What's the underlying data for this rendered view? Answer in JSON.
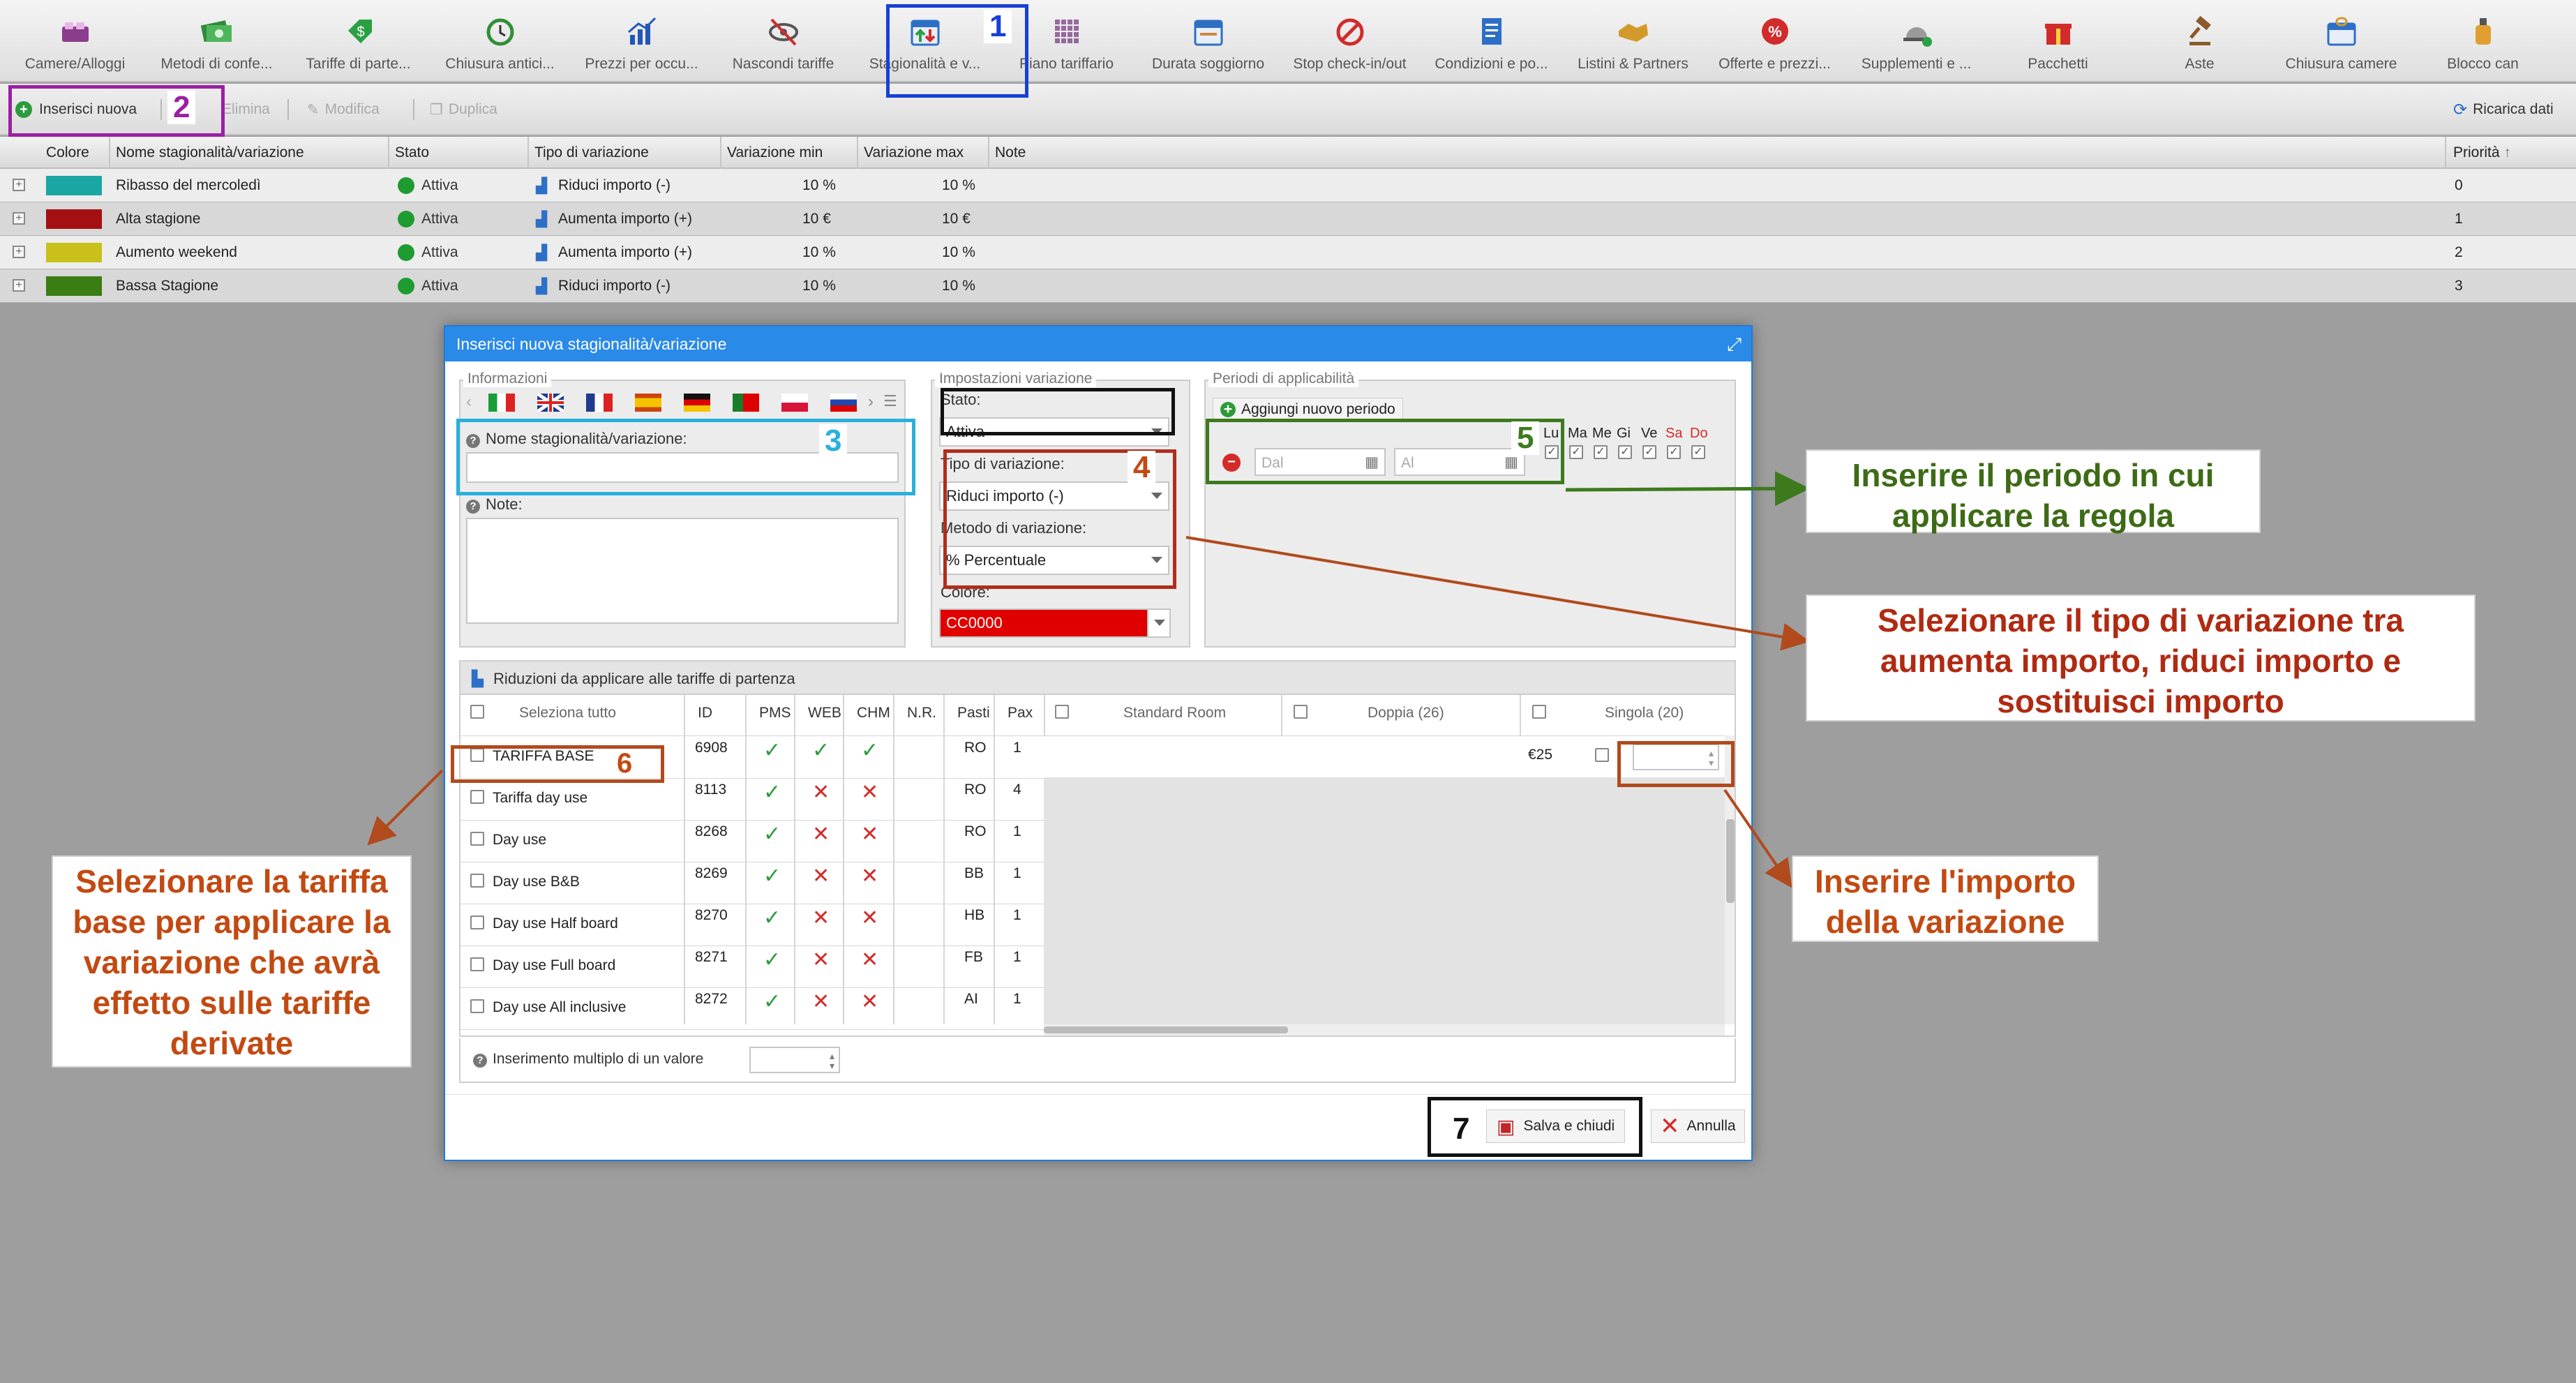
{
  "toolbar": [
    {
      "label": "Camere/Alloggi",
      "icon": "bed-icon",
      "color": "#8a3d8a"
    },
    {
      "label": "Metodi di confe...",
      "icon": "money-icon",
      "color": "#2e8b3a"
    },
    {
      "label": "Tariffe di parte...",
      "icon": "price-tag-icon",
      "color": "#2aa043"
    },
    {
      "label": "Chiusura antici...",
      "icon": "clock-refresh-icon",
      "color": "#2f8f3a"
    },
    {
      "label": "Prezzi per occu...",
      "icon": "bar-chart-icon",
      "color": "#2257b8"
    },
    {
      "label": "Nascondi tariffe",
      "icon": "eye-hidden-icon",
      "color": "#555555"
    },
    {
      "label": "Stagionalità e v...",
      "icon": "calendar-arrows-icon",
      "color": "#2d6fc7"
    },
    {
      "label": "Piano tariffario",
      "icon": "grid-plan-icon",
      "color": "#7a3e86"
    },
    {
      "label": "Durata soggiorno",
      "icon": "calendar-icon",
      "color": "#2f6fc2"
    },
    {
      "label": "Stop check-in/out",
      "icon": "stop-calendar-icon",
      "color": "#d12b2b"
    },
    {
      "label": "Condizioni e po...",
      "icon": "document-icon",
      "color": "#2d6fc7"
    },
    {
      "label": "Listini & Partners",
      "icon": "handshake-icon",
      "color": "#d39a2a"
    },
    {
      "label": "Offerte e prezzi...",
      "icon": "percent-badge-icon",
      "color": "#d12b2b"
    },
    {
      "label": "Supplementi e ...",
      "icon": "service-bell-icon",
      "color": "#555555"
    },
    {
      "label": "Pacchetti",
      "icon": "gift-icon",
      "color": "#d12b2b"
    },
    {
      "label": "Aste",
      "icon": "gavel-icon",
      "color": "#8a5a2a"
    },
    {
      "label": "Chiusura camere",
      "icon": "lock-calendar-icon",
      "color": "#2d6fc7"
    },
    {
      "label": "Blocco can",
      "icon": "bottle-icon",
      "color": "#e0a030"
    }
  ],
  "subbar": {
    "insert": "Inserisci nuova",
    "delete": "Elimina",
    "edit": "Modifica",
    "duplicate": "Duplica",
    "reload": "Ricarica dati"
  },
  "grid": {
    "columns": [
      "Colore",
      "Nome stagionalità/variazione",
      "Stato",
      "Tipo di variazione",
      "Variazione min",
      "Variazione max",
      "Note",
      "Priorità"
    ],
    "rows": [
      {
        "color": "#1aa7a3",
        "name": "Ribasso del mercoledì",
        "status": "Attiva",
        "type": "Riduci importo (-)",
        "min": "10 %",
        "max": "10 %",
        "priority": "0"
      },
      {
        "color": "#a40f12",
        "name": "Alta stagione",
        "status": "Attiva",
        "type": "Aumenta importo (+)",
        "min": "10 €",
        "max": "10 €",
        "priority": "1"
      },
      {
        "color": "#c9c01b",
        "name": "Aumento weekend",
        "status": "Attiva",
        "type": "Aumenta importo (+)",
        "min": "10 %",
        "max": "10 %",
        "priority": "2"
      },
      {
        "color": "#3a7d12",
        "name": "Bassa Stagione",
        "status": "Attiva",
        "type": "Riduci importo (-)",
        "min": "10 %",
        "max": "10 %",
        "priority": "3"
      }
    ]
  },
  "modal": {
    "title": "Inserisci nuova stagionalità/variazione",
    "info_legend": "Informazioni",
    "name_label": "Nome stagionalità/variazione:",
    "note_label": "Note:",
    "settings_legend": "Impostazioni variazione",
    "status_label": "Stato:",
    "status_value": "Attiva",
    "type_label": "Tipo di variazione:",
    "type_value": "Riduci importo (-)",
    "method_label": "Metodo di variazione:",
    "method_value": "% Percentuale",
    "color_label": "Colore:",
    "color_value": "CC0000",
    "color_hex": "#e00000",
    "periods_legend": "Periodi di applicabilità",
    "add_period": "Aggiungi nuovo periodo",
    "from_placeholder": "Dal",
    "to_placeholder": "Al",
    "days": [
      "Lu",
      "Ma",
      "Me",
      "Gi",
      "Ve",
      "Sa",
      "Do"
    ],
    "reductions_title": "Riduzioni da applicare alle tariffe di partenza",
    "select_all": "Seleziona tutto",
    "cols": [
      "ID",
      "PMS",
      "WEB",
      "CHM",
      "N.R.",
      "Pasti",
      "Pax"
    ],
    "room_cols": [
      "Standard Room",
      "Doppia (26)",
      "Singola (20)"
    ],
    "rates": [
      {
        "name": "TARIFFA BASE",
        "id": "6908",
        "pms": "ok",
        "web": "ok",
        "chm": "ok",
        "meal": "RO",
        "pax": "1",
        "price": "€25"
      },
      {
        "name": "Tariffa day use",
        "id": "8113",
        "pms": "ok",
        "web": "no",
        "chm": "no",
        "meal": "RO",
        "pax": "4",
        "price": ""
      },
      {
        "name": "Day use",
        "id": "8268",
        "pms": "ok",
        "web": "no",
        "chm": "no",
        "meal": "RO",
        "pax": "1",
        "price": ""
      },
      {
        "name": "Day use B&B",
        "id": "8269",
        "pms": "ok",
        "web": "no",
        "chm": "no",
        "meal": "BB",
        "pax": "1",
        "price": ""
      },
      {
        "name": "Day use Half board",
        "id": "8270",
        "pms": "ok",
        "web": "no",
        "chm": "no",
        "meal": "HB",
        "pax": "1",
        "price": ""
      },
      {
        "name": "Day use Full board",
        "id": "8271",
        "pms": "ok",
        "web": "no",
        "chm": "no",
        "meal": "FB",
        "pax": "1",
        "price": ""
      },
      {
        "name": "Day use All inclusive",
        "id": "8272",
        "pms": "ok",
        "web": "no",
        "chm": "no",
        "meal": "AI",
        "pax": "1",
        "price": ""
      }
    ],
    "multi_insert": "Inserimento multiplo di un valore",
    "save": "Salva e chiudi",
    "cancel": "Annulla"
  },
  "annotations": {
    "n1": "1",
    "n2": "2",
    "n3": "3",
    "n4": "4",
    "n5": "5",
    "n6": "6",
    "n7": "7",
    "period": "Inserire il periodo in cui applicare la regola",
    "type": "Selezionare il tipo di variazione tra aumenta importo, riduci importo e sostituisci importo",
    "base": "Selezionare la tariffa base per applicare la variazione che avrà effetto sulle tariffe derivate",
    "amount": "Inserire l'importo della variazione"
  }
}
